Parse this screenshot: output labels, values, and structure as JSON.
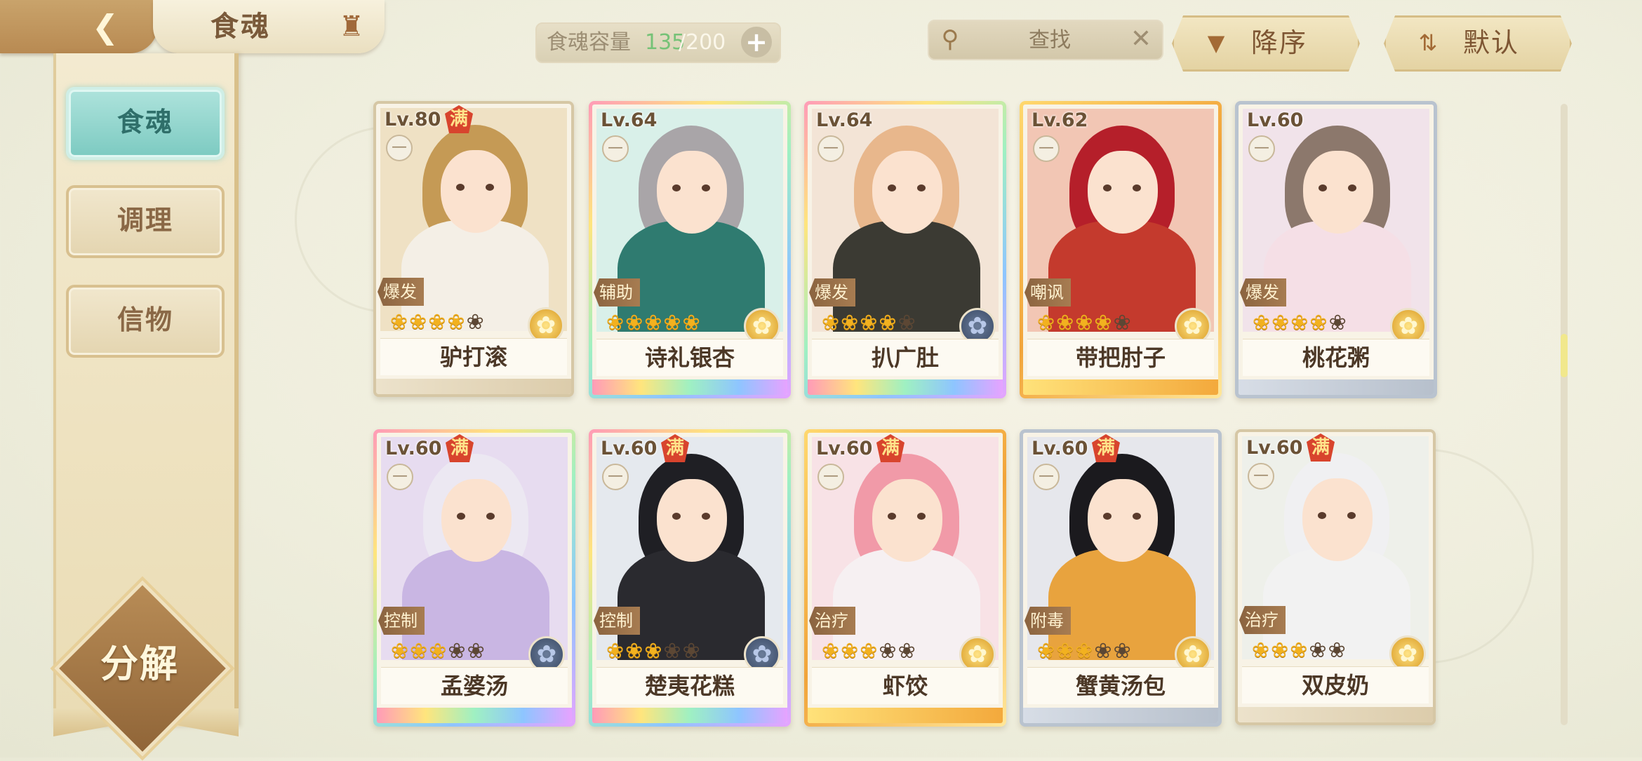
{
  "header": {
    "title": "食魂",
    "capacity_label": "食魂容量",
    "capacity_current": "135",
    "capacity_separator": "/",
    "capacity_max": "200",
    "search_placeholder": "查找",
    "sort_desc_label": "降序",
    "sort_default_label": "默认"
  },
  "sidebar": {
    "items": [
      {
        "label": "食魂",
        "active": true
      },
      {
        "label": "调理",
        "active": false
      },
      {
        "label": "信物",
        "active": false
      }
    ],
    "decompose_label": "分解"
  },
  "icons": {
    "back": "back-arrow-icon",
    "home": "pavilion-home-icon",
    "search": "magnifier-icon",
    "clear": "close-x-icon",
    "sort_desc": "down-triangle-icon",
    "sort_default": "swap-arrows-icon",
    "add": "plus-icon"
  },
  "colors": {
    "active_tab": "#7ccac1",
    "star_on": "#f2b11f",
    "full_badge": "#d8442d",
    "capacity_current": "#76c277"
  },
  "cards": [
    {
      "name": "驴打滚",
      "level": "Lv.80",
      "full": true,
      "full_label": "满",
      "role": "爆发",
      "stars_on": 4,
      "stars_total": 5,
      "element": "gold",
      "frame": "beige"
    },
    {
      "name": "诗礼银杏",
      "level": "Lv.64",
      "full": false,
      "role": "辅助",
      "stars_on": 5,
      "stars_total": 5,
      "element": "gold",
      "frame": "rainbow"
    },
    {
      "name": "扒广肚",
      "level": "Lv.64",
      "full": false,
      "role": "爆发",
      "stars_on": 4,
      "stars_total": 5,
      "element": "blue",
      "frame": "rainbow"
    },
    {
      "name": "带把肘子",
      "level": "Lv.62",
      "full": false,
      "role": "嘲讽",
      "stars_on": 4,
      "stars_total": 5,
      "element": "gold",
      "frame": "gold"
    },
    {
      "name": "桃花粥",
      "level": "Lv.60",
      "full": false,
      "role": "爆发",
      "stars_on": 4,
      "stars_total": 5,
      "element": "gold",
      "frame": "silver"
    },
    {
      "name": "孟婆汤",
      "level": "Lv.60",
      "full": true,
      "full_label": "满",
      "role": "控制",
      "stars_on": 3,
      "stars_total": 5,
      "element": "blue",
      "frame": "rainbow"
    },
    {
      "name": "楚夷花糕",
      "level": "Lv.60",
      "full": true,
      "full_label": "满",
      "role": "控制",
      "stars_on": 3,
      "stars_total": 5,
      "element": "blue",
      "frame": "rainbow"
    },
    {
      "name": "虾饺",
      "level": "Lv.60",
      "full": true,
      "full_label": "满",
      "role": "治疗",
      "stars_on": 3,
      "stars_total": 5,
      "element": "gold",
      "frame": "gold"
    },
    {
      "name": "蟹黄汤包",
      "level": "Lv.60",
      "full": true,
      "full_label": "满",
      "role": "附毒",
      "stars_on": 3,
      "stars_total": 5,
      "element": "gold",
      "frame": "silver"
    },
    {
      "name": "双皮奶",
      "level": "Lv.60",
      "full": true,
      "full_label": "满",
      "role": "治疗",
      "stars_on": 3,
      "stars_total": 5,
      "element": "gold",
      "frame": "beige"
    }
  ]
}
